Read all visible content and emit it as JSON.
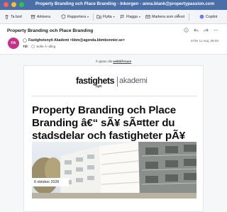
{
  "window": {
    "title": "Property Branding och Place Branding - Inkorgen - anna.blank@propertypassion.com"
  },
  "toolbar": {
    "delete_label": "Ta bort",
    "archive_label": "Arkivera",
    "report_label": "Rapportera",
    "move_label": "Flytta",
    "flag_label": "Flagga",
    "mark_read_label": "Markera som olÃ¤st",
    "copilot_label": "Copilot"
  },
  "message": {
    "subject": "Property Branding och Place Branding",
    "avatar_initials": "FA",
    "avatar_color": "#c9308a",
    "sender": "Fastighetsnytt Akademi <bbm@agenda.bbmbonnier.se>",
    "to_label": "Till:",
    "to_name": "Sofie Ã–dling",
    "date": "sÃ¶n 11 maj, 08:00"
  },
  "body": {
    "open_prefix": "Ã–ppna i din",
    "open_link": "webblÃ¤sare",
    "logo_main": "fastighets",
    "logo_sub": "nytt",
    "logo_right": "akademi",
    "headline": "Property Branding och Place Branding â€“ sÃ¥ sÃ¤tter du stadsdelar och fastigheter pÃ¥ kartan",
    "pub_date": "6 oktober 2026"
  },
  "colors": {
    "titlebar": "#4a6ea8",
    "accent": "#c9308a"
  }
}
